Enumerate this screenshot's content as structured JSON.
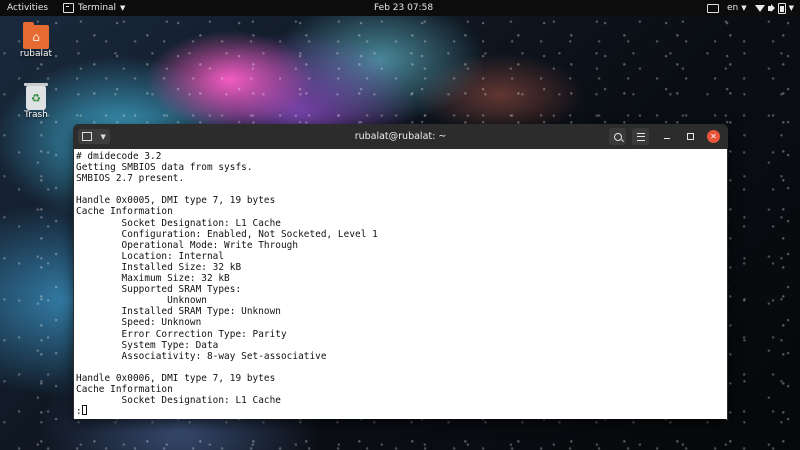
{
  "topbar": {
    "activities": "Activities",
    "app_name": "Terminal",
    "clock": "Feb 23  07:58",
    "language": "en",
    "icons": [
      "screen-icon",
      "wifi-icon",
      "volume-icon",
      "battery-icon"
    ]
  },
  "desktop": {
    "icons": [
      {
        "label": "rubalat",
        "icon": "home-folder-icon"
      },
      {
        "label": "Trash",
        "icon": "trash-icon"
      }
    ]
  },
  "terminal": {
    "title": "rubalat@rubalat: ~",
    "lines": [
      "# dmidecode 3.2",
      "Getting SMBIOS data from sysfs.",
      "SMBIOS 2.7 present.",
      "",
      "Handle 0x0005, DMI type 7, 19 bytes",
      "Cache Information",
      "        Socket Designation: L1 Cache",
      "        Configuration: Enabled, Not Socketed, Level 1",
      "        Operational Mode: Write Through",
      "        Location: Internal",
      "        Installed Size: 32 kB",
      "        Maximum Size: 32 kB",
      "        Supported SRAM Types:",
      "                Unknown",
      "        Installed SRAM Type: Unknown",
      "        Speed: Unknown",
      "        Error Correction Type: Parity",
      "        System Type: Data",
      "        Associativity: 8-way Set-associative",
      "",
      "Handle 0x0006, DMI type 7, 19 bytes",
      "Cache Information",
      "        Socket Designation: L1 Cache",
      ":"
    ]
  },
  "colors": {
    "close_button": "#e9553a",
    "home_folder": "#e66b33",
    "topbar_bg": "#0c0c0c",
    "terminal_bg": "#ffffff"
  }
}
